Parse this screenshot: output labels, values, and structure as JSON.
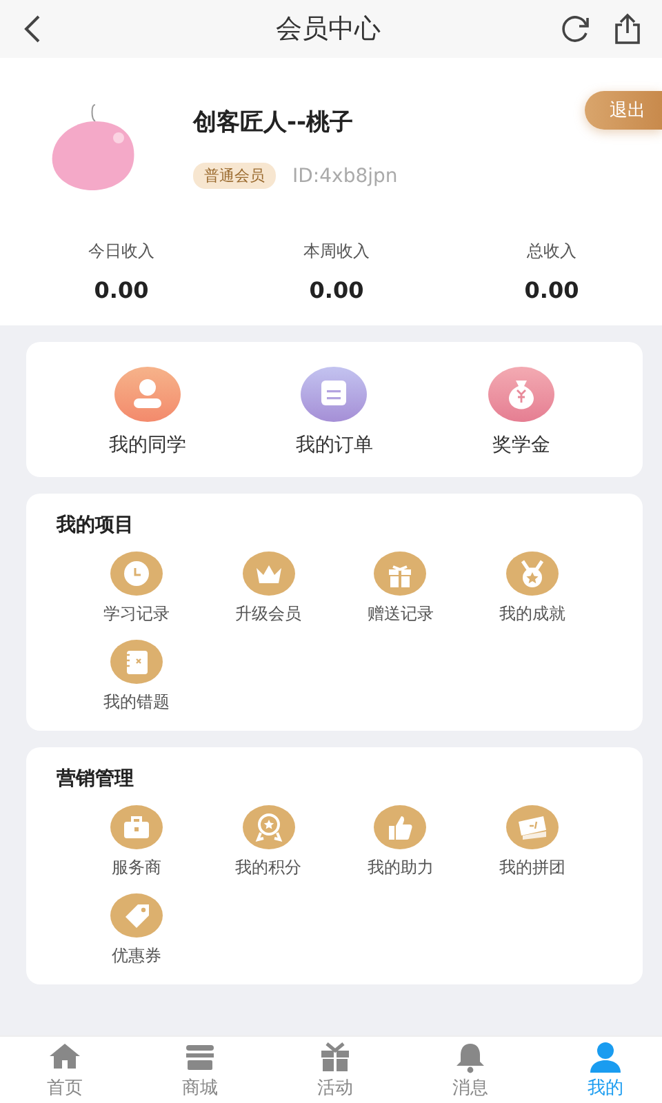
{
  "header": {
    "title": "会员中心"
  },
  "profile": {
    "name": "创客匠人--桃子",
    "badge": "普通会员",
    "id": "ID:4xb8jpn",
    "logout": "退出"
  },
  "stats": [
    {
      "label": "今日收入",
      "value": "0.00"
    },
    {
      "label": "本周收入",
      "value": "0.00"
    },
    {
      "label": "总收入",
      "value": "0.00"
    }
  ],
  "shortcuts": [
    {
      "label": "我的同学"
    },
    {
      "label": "我的订单"
    },
    {
      "label": "奖学金"
    }
  ],
  "sections": [
    {
      "title": "我的项目",
      "items": [
        "学习记录",
        "升级会员",
        "赠送记录",
        "我的成就",
        "我的错题"
      ]
    },
    {
      "title": "营销管理",
      "items": [
        "服务商",
        "我的积分",
        "我的助力",
        "我的拼团",
        "优惠券"
      ]
    }
  ],
  "tabbar": [
    {
      "label": "首页",
      "selected": false
    },
    {
      "label": "商城",
      "selected": false
    },
    {
      "label": "活动",
      "selected": false
    },
    {
      "label": "消息",
      "selected": false
    },
    {
      "label": "我的",
      "selected": true
    }
  ]
}
